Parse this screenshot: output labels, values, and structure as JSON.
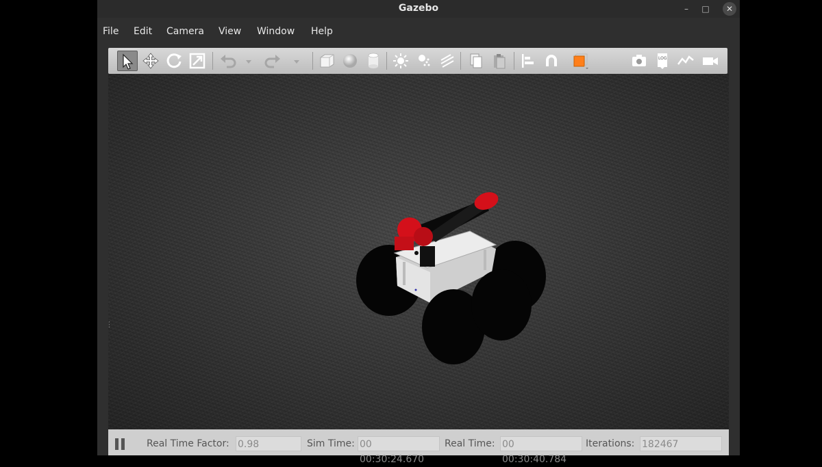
{
  "window": {
    "title": "Gazebo"
  },
  "menubar": {
    "items": [
      {
        "label": "File"
      },
      {
        "label": "Edit"
      },
      {
        "label": "Camera"
      },
      {
        "label": "View"
      },
      {
        "label": "Window"
      },
      {
        "label": "Help"
      }
    ]
  },
  "toolbar": {
    "icons": [
      "select-arrow-icon",
      "translate-icon",
      "rotate-icon",
      "scale-icon",
      "undo-icon",
      "redo-icon",
      "box-icon",
      "sphere-icon",
      "cylinder-icon",
      "point-light-icon",
      "spot-light-icon",
      "directional-light-icon",
      "copy-icon",
      "paste-icon",
      "align-icon",
      "snap-magnet-icon",
      "view-angle-icon",
      "screenshot-icon",
      "log-icon",
      "plot-icon",
      "video-record-icon"
    ]
  },
  "statusbar": {
    "real_time_factor_label": "Real Time Factor:",
    "real_time_factor": "0.98",
    "sim_time_label": "Sim Time:",
    "sim_time": "00 00:30:24.670",
    "real_time_label": "Real Time:",
    "real_time": "00 00:30:40.784",
    "iterations_label": "Iterations:",
    "iterations": "182467"
  },
  "colors": {
    "robot_arm": "#d4101a",
    "chassis": "#d9d9d9",
    "ground": "#3c3c3c"
  }
}
